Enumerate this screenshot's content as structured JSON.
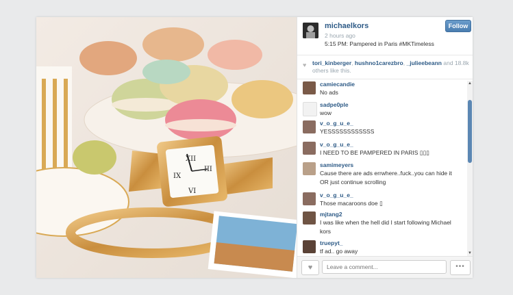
{
  "post": {
    "owner": "michaelkors",
    "time_ago": "2 hours ago",
    "caption": "5:15 PM: Pampered in Paris #MKTimeless",
    "follow_label": "Follow"
  },
  "likes": {
    "users": [
      "tori_kinberger",
      "hushno1carezbro",
      "_julieebeann"
    ],
    "count_text": "and 18.8k",
    "suffix": "others like this."
  },
  "comments": [
    {
      "user": "camiecandie",
      "text": "No ads"
    },
    {
      "user": "sadpe0ple",
      "text": "wow"
    },
    {
      "user": "v_o_g_u_e_",
      "text": "YESSSSSSSSSSSS"
    },
    {
      "user": "v_o_g_u_e_",
      "text": "I NEED TO BE PAMPERED IN PARIS ▯▯▯"
    },
    {
      "user": "samimeyers",
      "text": "Cause there are ads errwhere..fuck..you can hide it OR just continue scrolling"
    },
    {
      "user": "v_o_g_u_e_",
      "text": "Those macaroons doe ▯"
    },
    {
      "user": "mjtang2",
      "text": "I was like when the hell did I start following Michael kors"
    },
    {
      "user": "truepyt_",
      "text": "tf ad.. go away"
    }
  ],
  "footer": {
    "comment_placeholder": "Leave a comment...",
    "more_label": "•••"
  },
  "icons": {
    "like": "heart-icon",
    "more": "more-options-icon",
    "scroll_up": "scroll-up-icon",
    "scroll_down": "scroll-down-icon"
  },
  "colors": {
    "link": "#2d5a86",
    "follow_button": "#5a8cbf",
    "scroll_thumb": "#5b87b3"
  }
}
